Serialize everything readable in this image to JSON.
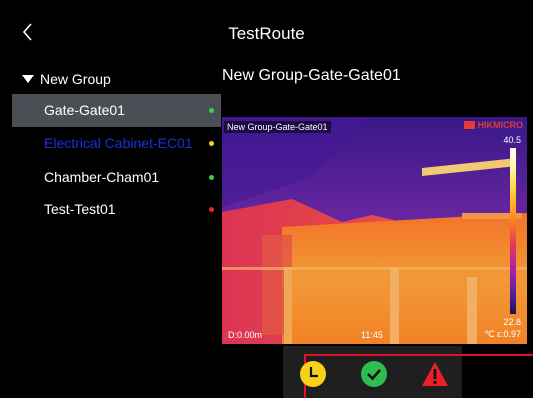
{
  "header": {
    "title": "TestRoute",
    "back_icon": "chevron-left-icon"
  },
  "sidebar": {
    "group": {
      "label": "New Group",
      "expanded": true
    },
    "items": [
      {
        "label": "Gate-Gate01",
        "status_color": "#3ecf5a",
        "selected": true,
        "label_color": "#ffffff"
      },
      {
        "label": "Electrical Cabinet-EC01",
        "status_color": "#f5d90a",
        "selected": false,
        "label_color": "#1a2fe0"
      },
      {
        "label": "Chamber-Cham01",
        "status_color": "#3ecf5a",
        "selected": false,
        "label_color": "#ffffff"
      },
      {
        "label": "Test-Test01",
        "status_color": "#e52630",
        "selected": false,
        "label_color": "#ffffff"
      }
    ]
  },
  "main": {
    "title": "New Group-Gate-Gate01",
    "thermal_view": {
      "path_label": "New Group-Gate-Gate01",
      "brand": "HIKMICRO",
      "max_temp": "40.5",
      "min_temp": "22.8",
      "distance": "D:0.00m",
      "time": "11:45",
      "emissivity": "℃  ε:0.97"
    }
  },
  "status_icons": [
    {
      "name": "clock-icon",
      "color": "#f7d117"
    },
    {
      "name": "check-circle-icon",
      "color": "#2ebd4e"
    },
    {
      "name": "warning-triangle-icon",
      "color": "#e8202a"
    }
  ]
}
